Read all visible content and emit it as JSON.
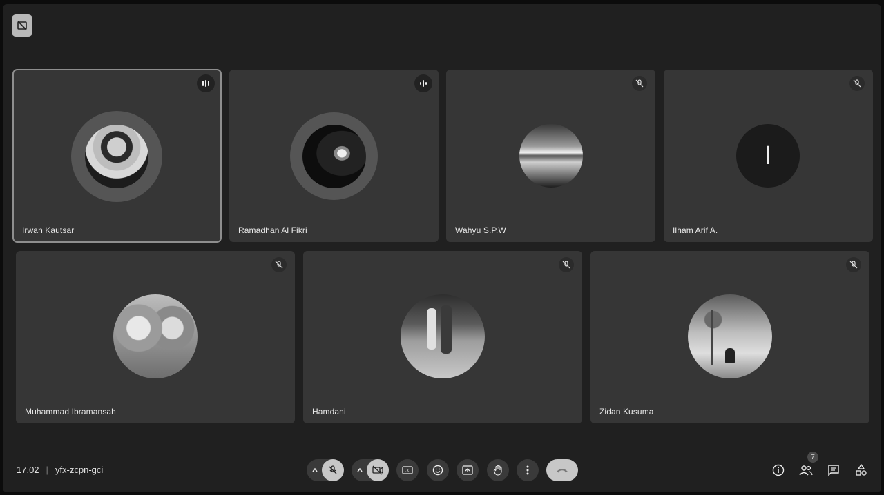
{
  "meeting": {
    "time": "17.02",
    "code": "yfx-zcpn-gci",
    "participant_count": "7"
  },
  "participants": [
    {
      "name": "Irwan Kautsar",
      "mic_state": "speaking",
      "avatar": "photo"
    },
    {
      "name": "Ramadhan Al Fikri",
      "mic_state": "speaking",
      "avatar": "photo"
    },
    {
      "name": "Wahyu S.P.W",
      "mic_state": "muted",
      "avatar": "photo"
    },
    {
      "name": "Ilham Arif A.",
      "mic_state": "muted",
      "avatar": "initial",
      "initial": "I"
    },
    {
      "name": "Muhammad Ibramansah",
      "mic_state": "muted",
      "avatar": "photo"
    },
    {
      "name": "Hamdani",
      "mic_state": "muted",
      "avatar": "photo"
    },
    {
      "name": "Zidan Kusuma",
      "mic_state": "muted",
      "avatar": "photo"
    }
  ],
  "controls": [
    "mic-options",
    "mic-toggle",
    "camera-options",
    "camera-toggle",
    "captions",
    "emoji",
    "present",
    "raise-hand",
    "more-options",
    "leave-call"
  ],
  "right_controls": [
    "meeting-details",
    "people",
    "chat",
    "activities"
  ],
  "theme": {
    "tile_bg": "#363636",
    "page_bg": "#202020",
    "leave_button": "#c7c7c7"
  }
}
